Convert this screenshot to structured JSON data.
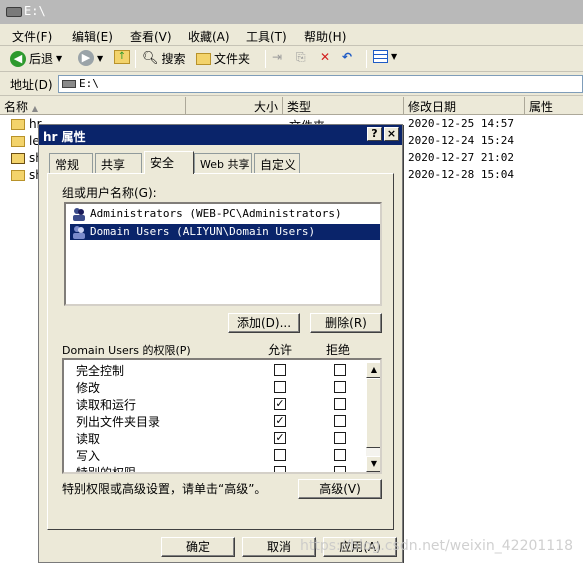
{
  "window": {
    "title": "E:\\"
  },
  "menu": [
    "文件(F)",
    "编辑(E)",
    "查看(V)",
    "收藏(A)",
    "工具(T)",
    "帮助(H)"
  ],
  "toolbar": {
    "back": "后退",
    "search": "搜索",
    "folders": "文件夹"
  },
  "address": {
    "label": "地址(D)",
    "value": "E:\\"
  },
  "list": {
    "columns": {
      "name": "名称",
      "size": "大小",
      "type": "类型",
      "modified": "修改日期",
      "attributes": "属性"
    },
    "rows": [
      {
        "name": "hr",
        "type": "文件夹",
        "date": "2020-12-25 14:57"
      },
      {
        "name": "le",
        "type": "",
        "date": "2020-12-24 15:24"
      },
      {
        "name": "sh",
        "type": "",
        "date": "2020-12-27 21:02"
      },
      {
        "name": "sh",
        "type": "",
        "date": "2020-12-28 15:04"
      }
    ]
  },
  "dialog": {
    "title": "hr 属性",
    "help": "?",
    "close": "×",
    "tabs": [
      "常规",
      "共享",
      "安全",
      "Web 共享",
      "自定义"
    ],
    "active_tab": "安全",
    "groups_label": "组或用户名称(G):",
    "groups": [
      {
        "name": "Administrators (WEB-PC\\Administrators)",
        "selected": false
      },
      {
        "name": "Domain Users (ALIYUN\\Domain Users)",
        "selected": true
      }
    ],
    "add_button": "添加(D)...",
    "remove_button": "删除(R)",
    "perm_label": "Domain Users 的权限(P)",
    "allow_header": "允许",
    "deny_header": "拒绝",
    "permissions": [
      {
        "name": "完全控制",
        "allow": false,
        "deny": false
      },
      {
        "name": "修改",
        "allow": false,
        "deny": false
      },
      {
        "name": "读取和运行",
        "allow": true,
        "deny": false
      },
      {
        "name": "列出文件夹目录",
        "allow": true,
        "deny": false
      },
      {
        "name": "读取",
        "allow": true,
        "deny": false
      },
      {
        "name": "写入",
        "allow": false,
        "deny": false
      },
      {
        "name": "特别的权限",
        "allow": false,
        "deny": false
      }
    ],
    "advanced_hint": "特别权限或高级设置，请单击“高级”。",
    "advanced_button": "高级(V)",
    "ok_button": "确定",
    "cancel_button": "取消",
    "apply_button": "应用(A)"
  },
  "watermark": "https://blog.csdn.net/weixin_42201118",
  "colors": {
    "selection": "#0a246a",
    "title_bar": "#0a246a",
    "dialog_bg": "#ece9d8"
  }
}
